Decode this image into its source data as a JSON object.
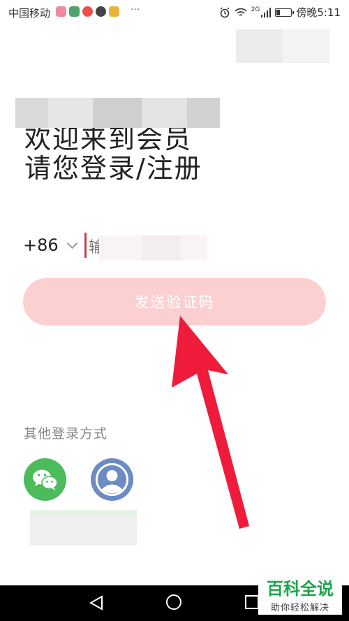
{
  "status_bar": {
    "carrier": "中国移动",
    "more": "···",
    "network": "2G",
    "time": "傍晚5:11",
    "battery_level": 0.3
  },
  "heading": {
    "line1": "欢迎来到会员",
    "line2": "请您登录/注册"
  },
  "phone": {
    "country_code": "+86",
    "placeholder": "输"
  },
  "buttons": {
    "send_code": "发送验证码"
  },
  "other_login": {
    "label": "其他登录方式",
    "options": [
      "wechat-icon",
      "user-icon"
    ]
  },
  "colors": {
    "send_button_bg": "#fcd0d0",
    "arrow": "#ee1c3a",
    "wechat": "#4cbb5c",
    "account": "#6b8bc4",
    "cursor": "#c83e4d"
  },
  "watermark": {
    "title": "百科全说",
    "subtitle": "助你轻松解决"
  }
}
